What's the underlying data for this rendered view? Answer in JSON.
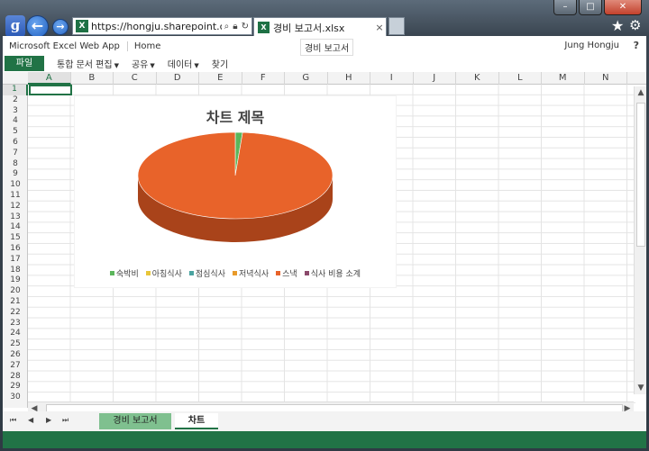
{
  "browser": {
    "logo": "g",
    "url": "https://hongju.sharepoint.com/",
    "tab_title": "경비 보고서.xlsx",
    "tab_close": "×",
    "tab_icon": "X",
    "icons": [
      "back-arrow-icon",
      "forward-arrow-icon",
      "search-icon",
      "lock-icon",
      "refresh-icon",
      "star-icon",
      "gear-icon"
    ]
  },
  "app": {
    "brand": "Microsoft Excel Web App",
    "home": "Home",
    "doc_title": "경비 보고서",
    "user": "Jung Hongju",
    "help": "?"
  },
  "ribbon": {
    "file": "파일",
    "items": [
      "통합 문서 편집",
      "공유",
      "데이터",
      "찾기"
    ]
  },
  "grid": {
    "columns": [
      "A",
      "B",
      "C",
      "D",
      "E",
      "F",
      "G",
      "H",
      "I",
      "J",
      "K",
      "L",
      "M",
      "N"
    ],
    "rows": [
      "1",
      "2",
      "3",
      "4",
      "5",
      "6",
      "7",
      "8",
      "9",
      "10",
      "11",
      "12",
      "13",
      "14",
      "15",
      "16",
      "17",
      "18",
      "19",
      "20",
      "21",
      "22",
      "23",
      "24",
      "25",
      "26",
      "27",
      "28",
      "29",
      "30"
    ],
    "selected_cell": "A1"
  },
  "sheets": {
    "tabs": [
      "경비 보고서",
      "차트"
    ],
    "active": "차트"
  },
  "colors": {
    "excel_green": "#217346",
    "pie_main": "#e8632a",
    "pie_side": "#a9431a"
  },
  "chart_data": {
    "type": "pie",
    "title": "차트 제목",
    "categories": [
      "숙박비",
      "아침식사",
      "점심식사",
      "저녁식사",
      "스낵",
      "식사 비용 소계"
    ],
    "colors": [
      "#5bb65b",
      "#e8c63a",
      "#4aa3a0",
      "#e89a2a",
      "#e8632a",
      "#8b4a6b"
    ],
    "values": [
      1.2,
      0,
      0,
      0,
      98.8,
      0
    ],
    "style": "3d",
    "legend_position": "bottom"
  }
}
